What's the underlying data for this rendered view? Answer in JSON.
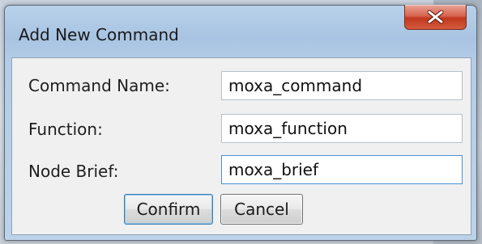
{
  "dialog": {
    "title": "Add New Command",
    "close_icon": "close-x-icon"
  },
  "form": {
    "command_name": {
      "label": "Command Name:",
      "value": "moxa_command"
    },
    "function": {
      "label": "Function:",
      "value": "moxa_function"
    },
    "node_brief": {
      "label": "Node Brief:",
      "value": "moxa_brief"
    }
  },
  "buttons": {
    "confirm": "Confirm",
    "cancel": "Cancel"
  },
  "colors": {
    "close_button": "#c0391f",
    "focus_border": "#4a90d9",
    "frame": "#a8c4e2"
  }
}
